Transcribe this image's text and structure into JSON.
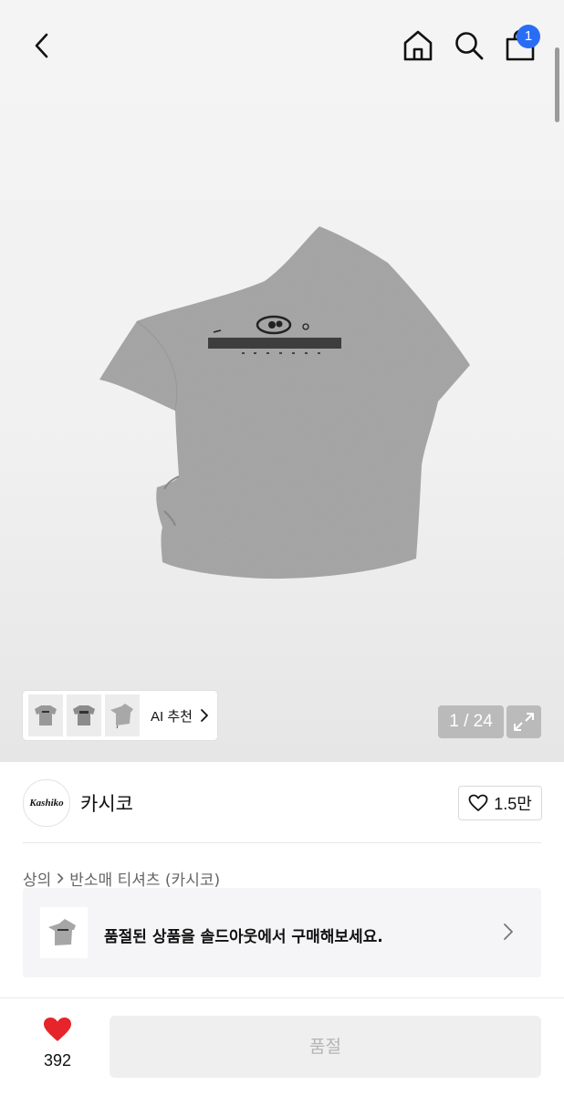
{
  "header": {
    "cart_badge": "1",
    "icons": [
      "back-icon",
      "home-icon",
      "search-icon",
      "cart-icon"
    ]
  },
  "gallery": {
    "ai_label": "AI 추천",
    "counter": "1 / 24"
  },
  "brand": {
    "logo_text": "Kashiko",
    "name": "카시코",
    "likes": "1.5만"
  },
  "breadcrumb": {
    "category": "상의",
    "subcategory": "반소매 티셔츠 (카시코)"
  },
  "soldout_banner": {
    "text": "품절된 상품을 솔드아웃에서 구매해보세요."
  },
  "bottom": {
    "wish_count": "392",
    "button_label": "품절"
  },
  "colors": {
    "badge": "#2a6df5",
    "heart": "#e5252a",
    "shirt": "#a3a3a3"
  }
}
